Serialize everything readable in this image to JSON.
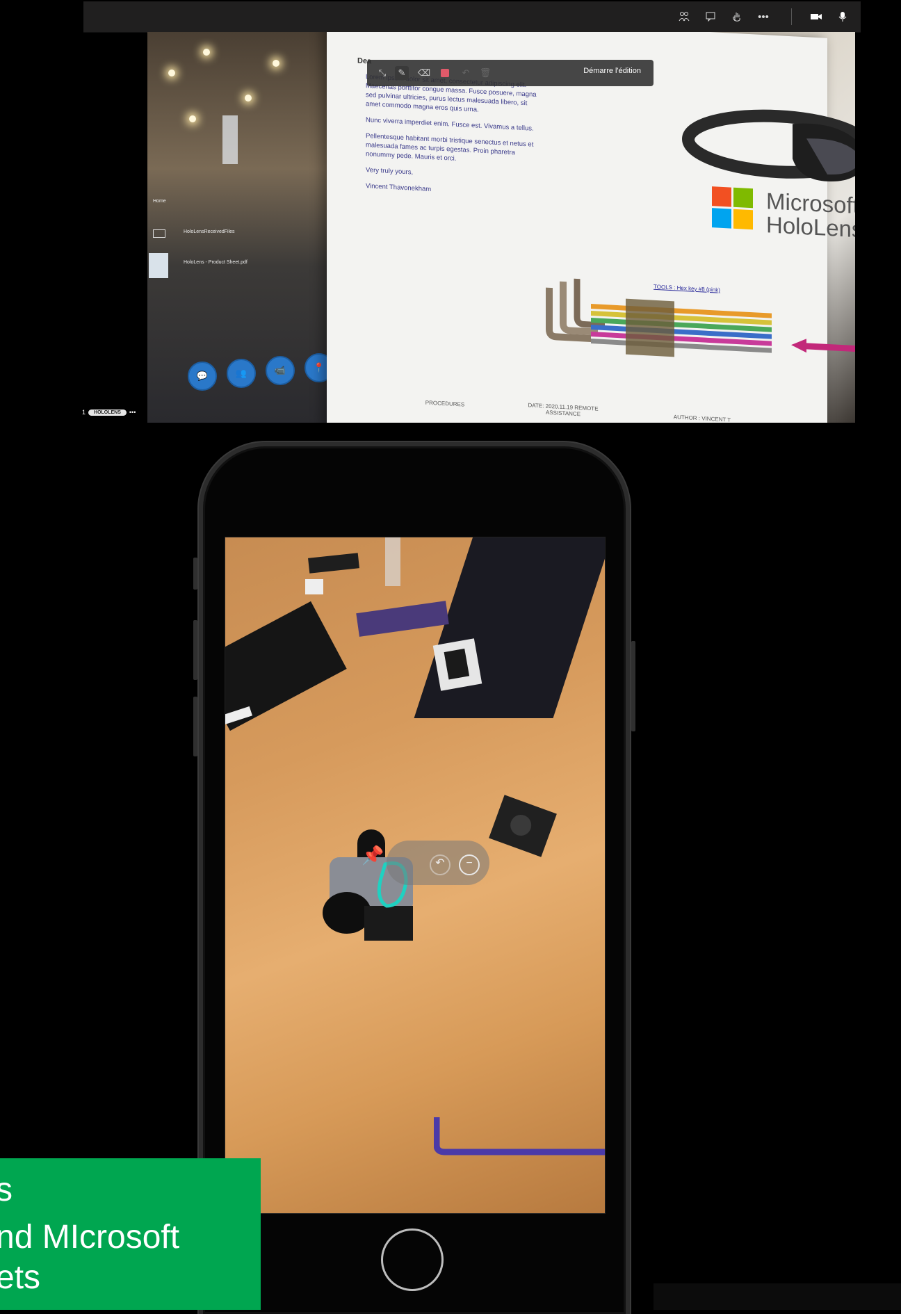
{
  "call": {
    "toolbar": {
      "icons": [
        "participants-icon",
        "chat-icon",
        "raise-hand-icon",
        "more-icon",
        "camera-icon",
        "microphone-icon"
      ],
      "more_label": "•••"
    },
    "participant": {
      "index": "1",
      "name": "HOLOLENS",
      "menu": "•••"
    }
  },
  "hololens_view": {
    "hud": {
      "home_label": "Home",
      "file1": "HoloLensReceivedFiles",
      "file2": "HoloLens - Product Sheet.pdf"
    },
    "ink_toolbar": {
      "edit_label": "Démarre l'édition"
    },
    "document": {
      "heading": "Dea",
      "paragraphs": [
        "Lorem ipsum dolor sit amet, consectetur adipiscing elit. Maecenas porttitor congue massa. Fusce posuere, magna sed pulvinar ultricies, purus lectus malesuada libero, sit amet commodo magna eros quis urna.",
        "Nunc viverra imperdiet enim. Fusce est. Vivamus a tellus.",
        "Pellentesque habitant morbi tristique senectus et netus et malesuada fames ac turpis egestas. Proin pharetra nonummy pede. Mauris et orci.",
        "Very truly yours,",
        "Vincent Thavonekham"
      ],
      "brand_line1": "Microsoft",
      "brand_line2": "HoloLens",
      "tools_label": "TOOLS : Hex key #8 (pink)",
      "footer": [
        "PROCEDURES",
        "DATE: 2020.11.19 REMOTE ASSISTANCE",
        "AUTHOR : VINCENT T"
      ]
    }
  },
  "caption": {
    "line1": "s",
    "line2": "nd MIcrosoft",
    "line3": "ets",
    "color": "#00a650"
  }
}
